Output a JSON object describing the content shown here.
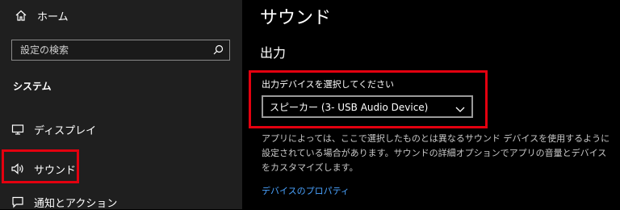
{
  "sidebar": {
    "home_label": "ホーム",
    "search_placeholder": "設定の検索",
    "section_title": "システム",
    "items": [
      {
        "label": "ディスプレイ",
        "icon": "monitor-icon"
      },
      {
        "label": "サウンド",
        "icon": "speaker-icon",
        "selected": true
      },
      {
        "label": "通知とアクション",
        "icon": "notification-icon"
      }
    ]
  },
  "main": {
    "title": "サウンド",
    "output_heading": "出力",
    "device_select_label": "出力デバイスを選択してください",
    "device_select_value": "スピーカー (3- USB Audio Device)",
    "description": "アプリによっては、ここで選択したものとは異なるサウンド デバイスを使用するように設定されている場合があります。サウンドの詳細オプションでアプリの音量とデバイスをカスタマイズします。",
    "device_properties_link": "デバイスのプロパティ"
  },
  "colors": {
    "highlight_box": "#e3000f",
    "link": "#4aa3ff",
    "sidebar_bg": "#1f1f1f",
    "content_bg": "#000000"
  }
}
